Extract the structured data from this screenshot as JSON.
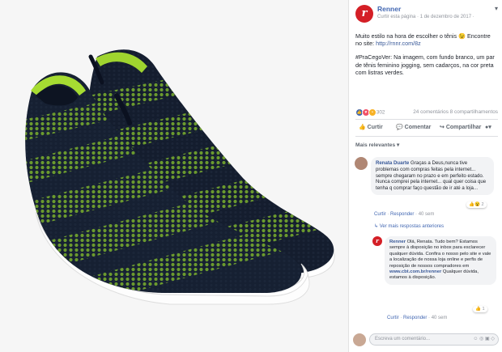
{
  "post": {
    "page_name": "Renner",
    "meta": "Curtir esta página · 1 de dezembro de 2017 ·",
    "text_line1": "Muito estilo na hora de escolher o tênis 😉 Encontre no site: ",
    "link": "http://rnnr.com/8z",
    "text_line2": "#PraCegoVer: Na imagem, com fundo branco, um par de tênis feminino jogging, sem cadarços, na cor preta com listras verdes.",
    "reaction_count": "302",
    "comments_shares": "24 comentários  8 compartilhamentos"
  },
  "actions": {
    "like": "Curtir",
    "comment": "Comentar",
    "share": "Compartilhar"
  },
  "comments_sort": "Mais relevantes ▾",
  "comments": [
    {
      "name": "Renata Duarte",
      "text": "Graças a Deus,nunca tive problemas com compras feitas pela internet... sempre chegaram no prazo e em perfeito estado. Nunca comprei pela internet... qual quer coisa que tenha q comprar faço questão de ir até a loja...",
      "reactions": "2",
      "like": "Curtir",
      "reply": "Responder",
      "time": "40 sem"
    },
    {
      "name": "Renner",
      "text": "Olá, Renata. Tudo bem? Estamos sempre à disposição no inbox para esclarecer qualquer dúvida. Confira o nosso pelo site e vale a localização de nossa loja online e perfis de reposição de nossos compradores em ",
      "link": "www.cbt.com.br/renner",
      "text2": " Qualquer dúvida, estamos à disposição.",
      "reactions": "1",
      "like": "Curtir",
      "reply": "Responder",
      "time": "40 sem"
    }
  ],
  "more_replies": "Ver mais respostas anteriores",
  "write_placeholder": "Escreva um comentário...",
  "colors": {
    "fb_blue": "#4267b2",
    "brand_red": "#d41f26",
    "shoe_body": "#162032",
    "shoe_stripe": "#5f8f2c",
    "sole": "#ffffff"
  }
}
